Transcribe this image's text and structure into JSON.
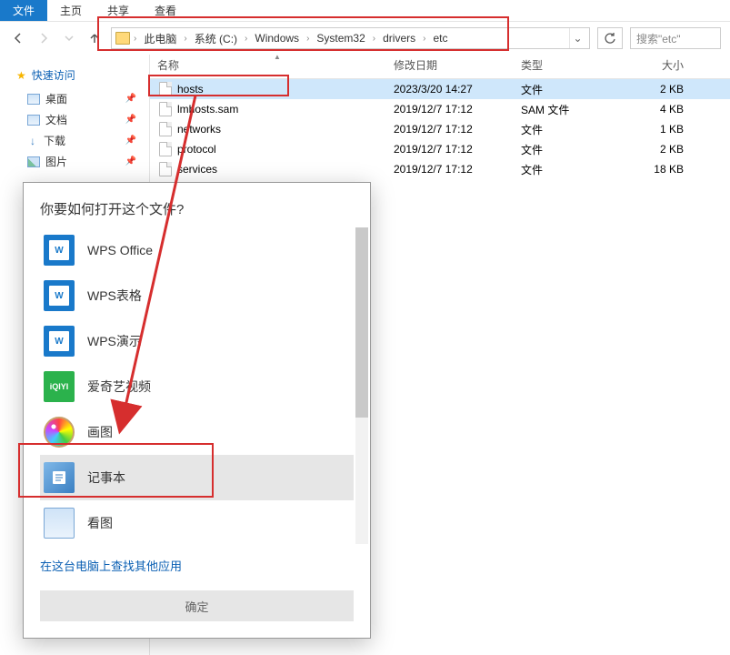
{
  "ribbon": {
    "file": "文件",
    "home": "主页",
    "share": "共享",
    "view": "查看"
  },
  "breadcrumbs": [
    "此电脑",
    "系统 (C:)",
    "Windows",
    "System32",
    "drivers",
    "etc"
  ],
  "search_placeholder": "搜索\"etc\"",
  "columns": {
    "name": "名称",
    "date": "修改日期",
    "type": "类型",
    "size": "大小"
  },
  "files": [
    {
      "name": "hosts",
      "date": "2023/3/20 14:27",
      "type": "文件",
      "size": "2 KB",
      "selected": true
    },
    {
      "name": "lmhosts.sam",
      "date": "2019/12/7 17:12",
      "type": "SAM 文件",
      "size": "4 KB"
    },
    {
      "name": "networks",
      "date": "2019/12/7 17:12",
      "type": "文件",
      "size": "1 KB"
    },
    {
      "name": "protocol",
      "date": "2019/12/7 17:12",
      "type": "文件",
      "size": "2 KB"
    },
    {
      "name": "services",
      "date": "2019/12/7 17:12",
      "type": "文件",
      "size": "18 KB"
    }
  ],
  "sidebar": {
    "quick": "快速访问",
    "items": [
      "桌面",
      "文档",
      "下载",
      "图片"
    ]
  },
  "dialog": {
    "title": "你要如何打开这个文件?",
    "apps": [
      {
        "label": "WPS Office",
        "icon": "wps"
      },
      {
        "label": "WPS表格",
        "icon": "wps"
      },
      {
        "label": "WPS演示",
        "icon": "wps"
      },
      {
        "label": "爱奇艺视频",
        "icon": "iqiyi"
      },
      {
        "label": "画图",
        "icon": "paint"
      },
      {
        "label": "记事本",
        "icon": "note",
        "selected": true
      },
      {
        "label": "看图",
        "icon": "view"
      }
    ],
    "more": "在这台电脑上查找其他应用",
    "ok": "确定"
  }
}
